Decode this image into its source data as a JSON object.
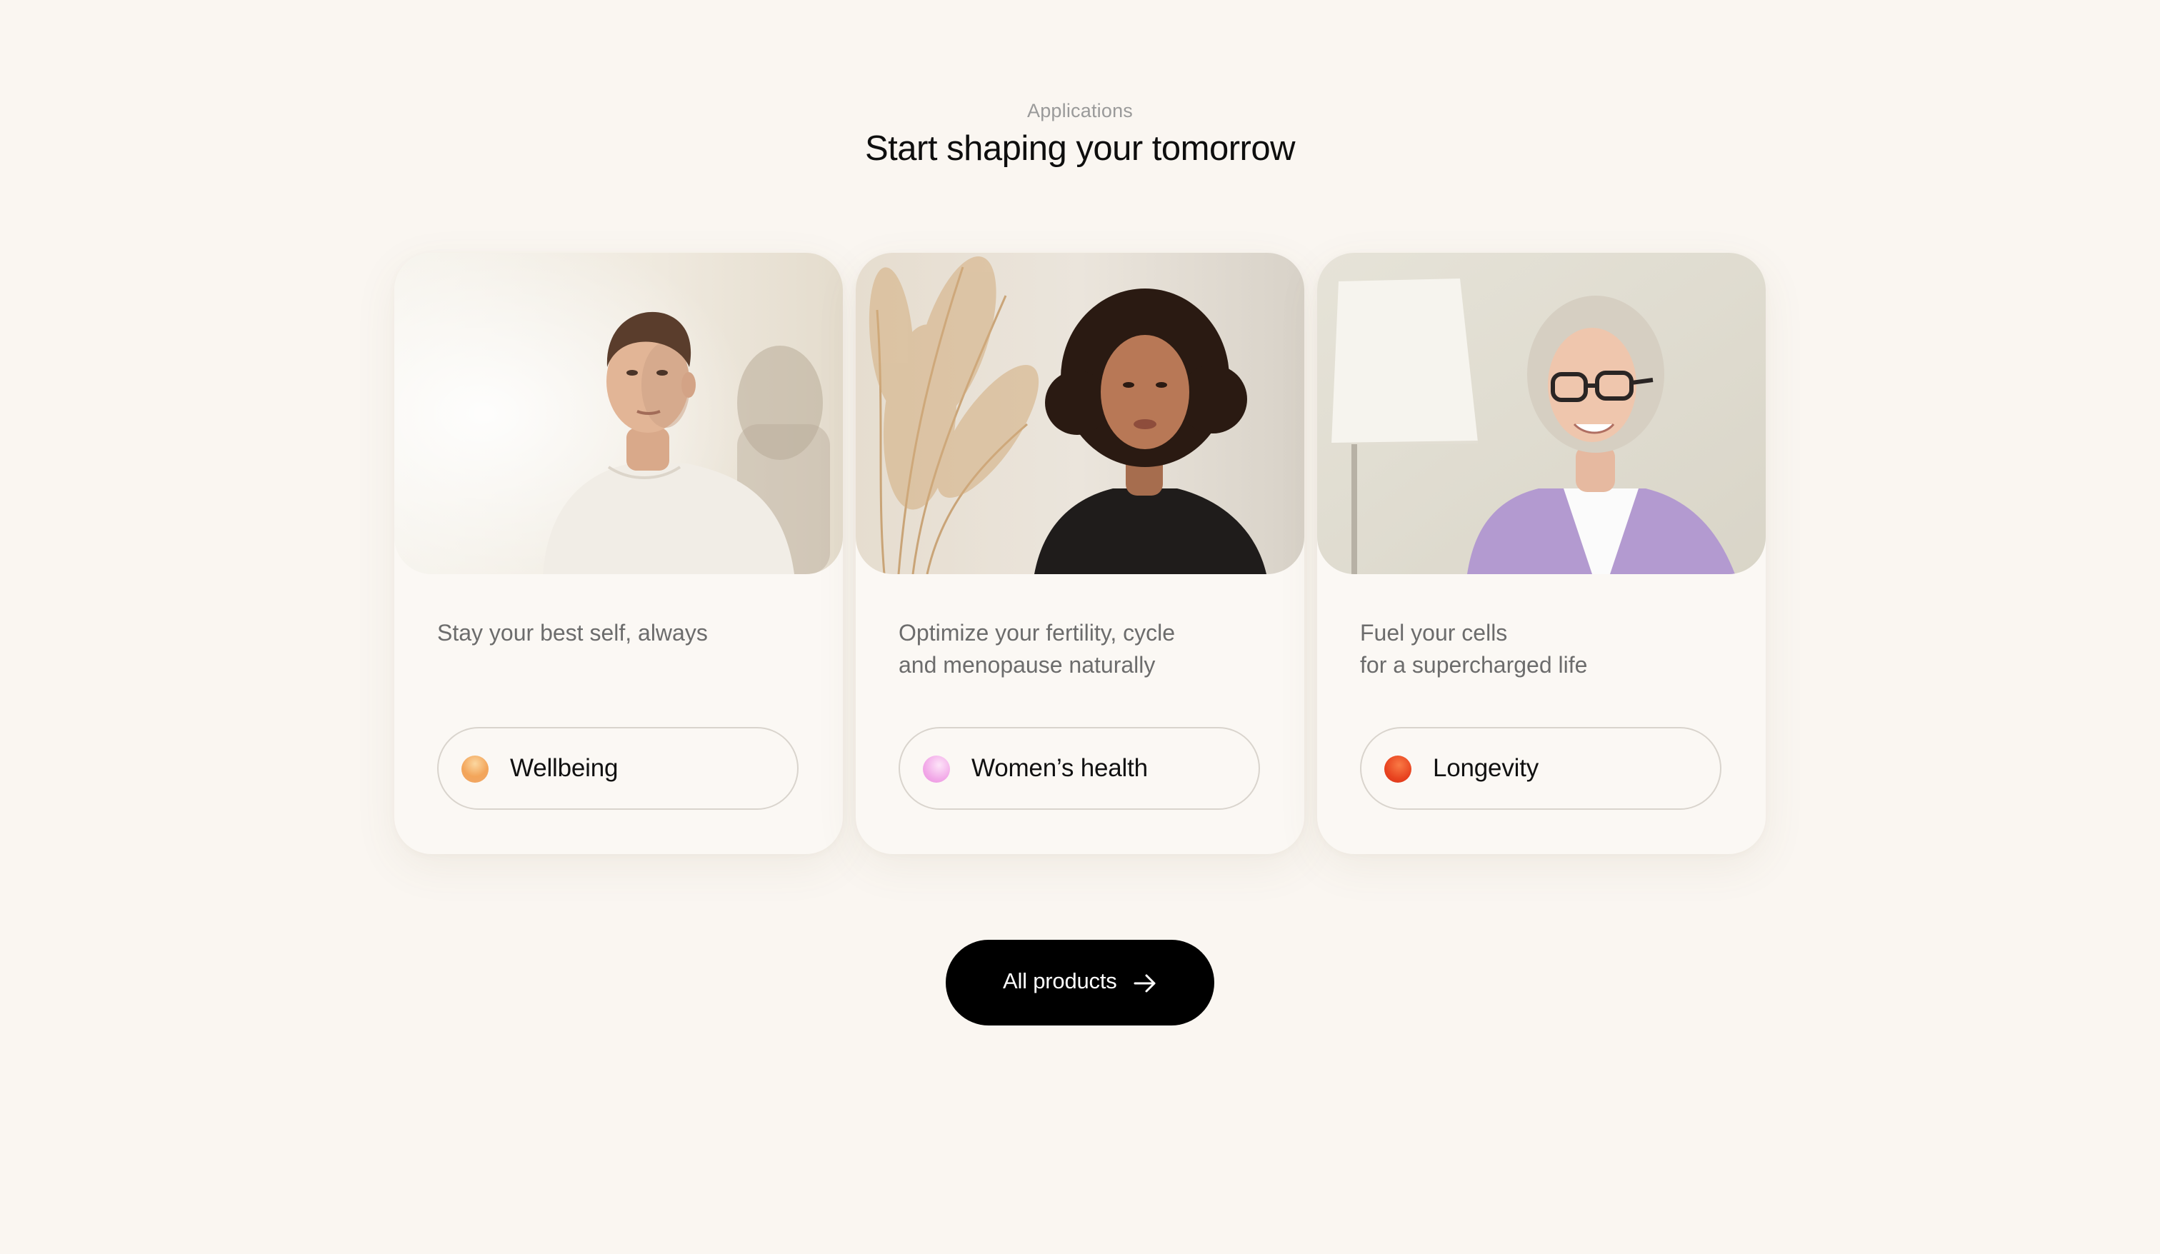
{
  "section": {
    "eyebrow": "Applications",
    "title": "Start shaping your tomorrow"
  },
  "cards": [
    {
      "image_alt": "Young man in a white t-shirt standing in sunlight",
      "description_lines": [
        "Stay your best self, always"
      ],
      "tag_label": "Wellbeing",
      "tag_color": "#f1a35b"
    },
    {
      "image_alt": "Young woman with curly hair beside pampas grass",
      "description_lines": [
        "Optimize your fertility, cycle",
        "and menopause naturally"
      ],
      "tag_label": "Women’s health",
      "tag_color": "#f29ee6"
    },
    {
      "image_alt": "Smiling older woman with glasses in a lilac shirt next to a lamp",
      "description_lines": [
        "Fuel your cells",
        "for a supercharged life"
      ],
      "tag_label": "Longevity",
      "tag_color": "#e8431f"
    }
  ],
  "cta": {
    "label": "All products",
    "icon": "arrow-right-icon"
  }
}
